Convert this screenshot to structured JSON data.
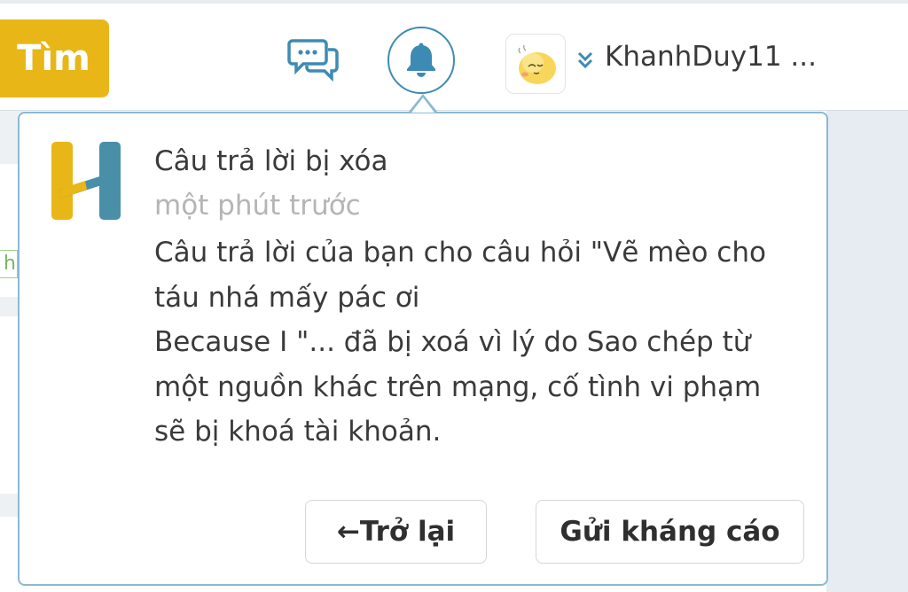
{
  "header": {
    "search_label": "Tìm",
    "username": "KhanhDuy11 ..."
  },
  "icons": {
    "chat": "chat-bubbles-icon",
    "bell": "bell-icon",
    "avatar": "cartoon-avatar",
    "chevron": "chevron-double-down-icon",
    "logo": "hoc247-h-logo"
  },
  "side_tag": "h",
  "notification": {
    "title": "Câu trả lời bị xóa",
    "time": "một phút trước",
    "body_lines": [
      "Câu trả lời của bạn cho câu hỏi \"Vẽ mèo cho",
      "táu nhá mấy pác ơi",
      "Because I  \"... đã bị xoá vì lý do Sao chép từ",
      "một nguồn khác trên mạng, cố tình vi phạm",
      "sẽ bị khoá tài khoản."
    ],
    "back_label": "←Trở lại",
    "appeal_label": "Gửi kháng cáo"
  },
  "colors": {
    "accent_yellow": "#e8b617",
    "accent_blue": "#3d8bb4",
    "popover_border": "#8bb9d2",
    "logo_teal": "#4a8fa8"
  }
}
